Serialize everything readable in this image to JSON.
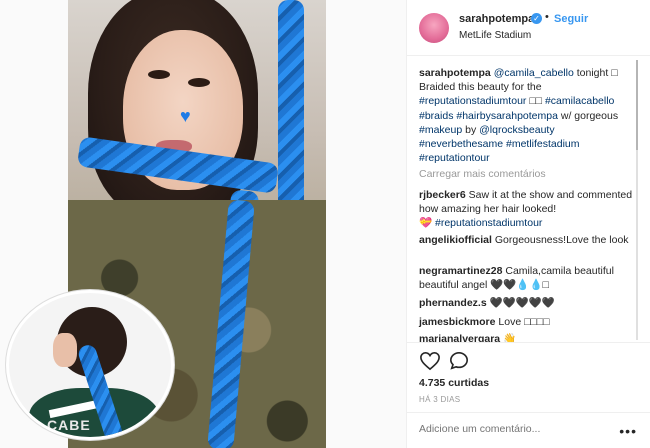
{
  "post": {
    "username": "sarahpotempa",
    "follow_label": "Seguir",
    "location": "MetLife Stadium",
    "verified": true
  },
  "caption": {
    "author": "sarahpotempa",
    "mention": "@camila_cabello",
    "text1": " tonight ",
    "glyph": "□",
    "text2": "Braided this beauty for the",
    "tag1": "#reputationstadiumtour",
    "sep1": " □□ ",
    "tag2": "#camilacabello",
    "tag3": "#braids",
    "tag4": "#hairbysarahpotempa",
    "text3": " w/ gorgeous",
    "tag5": "#makeup",
    "text4": " by ",
    "mention2": "@lqrocksbeauty",
    "tag6": "#neverbethesame",
    "tag7": "#metlifestadium",
    "tag8": "#reputationtour"
  },
  "load_more_label": "Carregar mais comentários",
  "comments": [
    {
      "user": "rjbecker6",
      "text": "Saw it at the show and commented how amazing her hair looked!",
      "emoji": "💝",
      "tag": "#reputationstadiumtour"
    },
    {
      "user": "angelikiofficial",
      "text": "Gorgeousness!Love the look"
    },
    {
      "user": "negramartinez28",
      "text": "Camila,camila beautiful beautiful angel",
      "emoji": "🖤🖤💧💧□"
    },
    {
      "user": "phernandez.s",
      "emoji": "🖤🖤🖤🖤🖤"
    },
    {
      "user": "jamesbickmore",
      "text": "Love",
      "emoji": "□□□□"
    },
    {
      "user": "marianalvergara",
      "emoji": "👋"
    }
  ],
  "likes": "4.735 curtidas",
  "ago": "HÁ 3 DIAS",
  "add_comment_placeholder": "Adicione um comentário...",
  "more_icon": "•••",
  "inset_text": "CABE"
}
